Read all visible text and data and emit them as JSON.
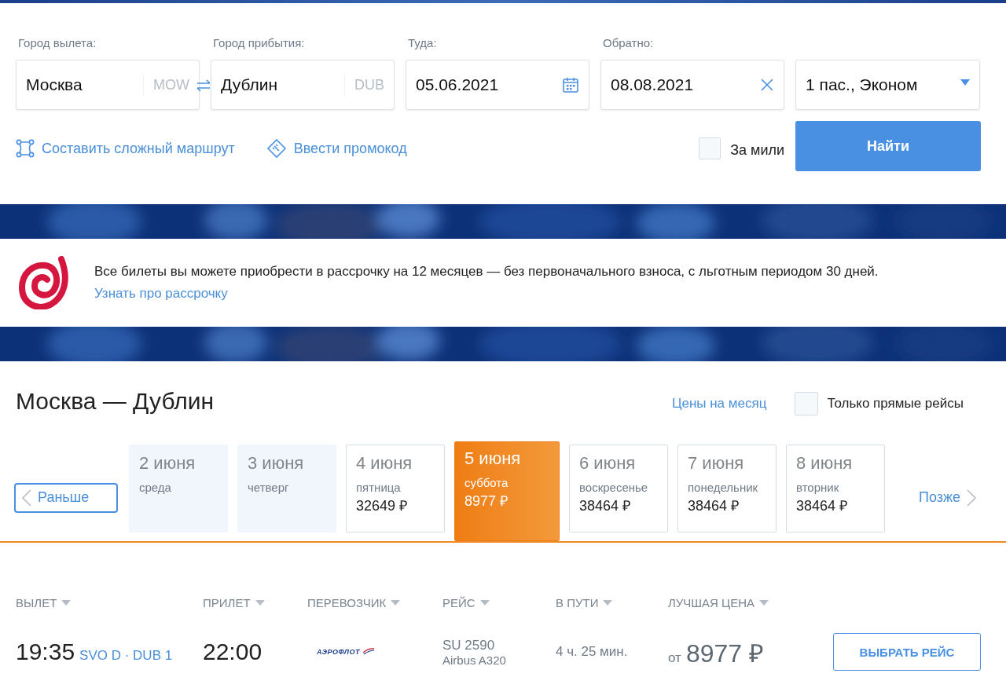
{
  "search": {
    "fields": [
      {
        "kind": "city",
        "label": "Город вылета:",
        "value": "Москва",
        "code": "MOW"
      },
      {
        "kind": "city",
        "label": "Город прибытия:",
        "value": "Дублин",
        "code": "DUB"
      },
      {
        "kind": "date",
        "label": "Туда:",
        "value": "05.06.2021"
      },
      {
        "kind": "date",
        "label": "Обратно:",
        "value": "08.08.2021"
      },
      {
        "kind": "select",
        "value": "1 пас., Эконом"
      }
    ],
    "links": [
      {
        "kind": "route",
        "label": "Составить сложный маршрут"
      },
      {
        "kind": "promo",
        "label": "Ввести промокод"
      }
    ],
    "miles": {
      "label": "За мили",
      "checked": false
    },
    "find_button": "Найти"
  },
  "installment": {
    "text": "Все билеты вы можете приобрести в рассрочку на 12 месяцев — без первоначального взноса, с льготным периодом 30 дней.",
    "link": "Узнать про рассрочку"
  },
  "results": {
    "title": "Москва — Дублин",
    "month_prices": "Цены на месяц",
    "direct_only": {
      "label": "Только прямые рейсы",
      "checked": false
    },
    "earlier": "Раньше",
    "later": "Позже",
    "days": [
      {
        "date": "2 июня",
        "weekday": "среда",
        "disabled": true,
        "selected": false
      },
      {
        "date": "3 июня",
        "weekday": "четверг",
        "disabled": true,
        "selected": false
      },
      {
        "date": "4 июня",
        "weekday": "пятница",
        "price": "32649 ₽",
        "disabled": false,
        "selected": false
      },
      {
        "date": "5 июня",
        "weekday": "суббота",
        "price": "8977 ₽",
        "disabled": false,
        "selected": true
      },
      {
        "date": "6 июня",
        "weekday": "воскресенье",
        "price": "38464 ₽",
        "disabled": false,
        "selected": false
      },
      {
        "date": "7 июня",
        "weekday": "понедельник",
        "price": "38464 ₽",
        "disabled": false,
        "selected": false
      },
      {
        "date": "8 июня",
        "weekday": "вторник",
        "price": "38464 ₽",
        "disabled": false,
        "selected": false
      }
    ],
    "columns": [
      "ВЫЛЕТ",
      "ПРИЛЕТ",
      "ПЕРЕВОЗЧИК",
      "РЕЙС",
      "В ПУТИ",
      "ЛУЧШАЯ ЦЕНА"
    ],
    "flights": [
      {
        "departure_time": "19:35",
        "airports": "SVO D · DUB 1",
        "arrival_time": "22:00",
        "carrier": "АЭРОФЛОТ",
        "flight_number": "SU 2590",
        "aircraft": "Airbus A320",
        "duration": "4 ч. 25 мин.",
        "price_prefix": "от",
        "price": "8977 ₽",
        "select_button": "ВЫБРАТЬ РЕЙС"
      }
    ]
  }
}
